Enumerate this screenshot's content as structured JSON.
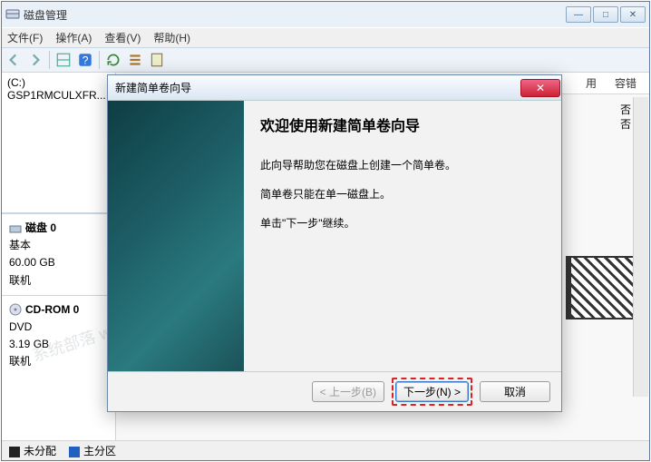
{
  "window": {
    "title": "磁盘管理",
    "controls": {
      "min": "—",
      "max": "□",
      "close": "✕"
    }
  },
  "menu": {
    "file": "文件(F)",
    "action": "操作(A)",
    "view": "查看(V)",
    "help": "帮助(H)"
  },
  "columns": {
    "col1": "用",
    "col2": "容错",
    "val": "否"
  },
  "volume": {
    "letter": "(C:)",
    "name": "GSP1RMCULXFR..."
  },
  "disk0": {
    "name": "磁盘 0",
    "type": "基本",
    "size": "60.00 GB",
    "status": "联机"
  },
  "cdrom": {
    "name": "CD-ROM 0",
    "type": "DVD",
    "size": "3.19 GB",
    "status": "联机"
  },
  "legend": {
    "una": "未分配",
    "pri": "主分区"
  },
  "dialog": {
    "title": "新建简单卷向导",
    "heading": "欢迎使用新建简单卷向导",
    "p1": "此向导帮助您在磁盘上创建一个简单卷。",
    "p2": "简单卷只能在单一磁盘上。",
    "p3": "单击\"下一步\"继续。",
    "back": "< 上一步(B)",
    "next": "下一步(N) >",
    "cancel": "取消"
  },
  "watermark": "系统部落 www.xitongbuluo.com"
}
